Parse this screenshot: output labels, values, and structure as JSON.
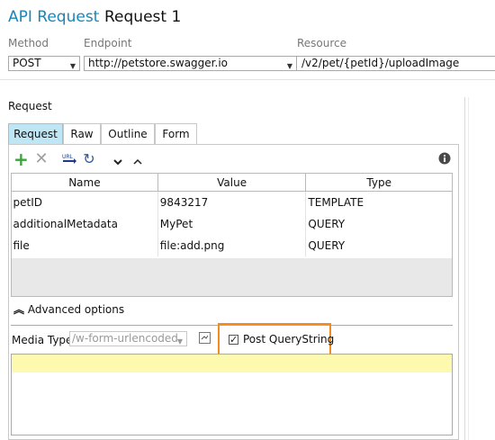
{
  "header": {
    "title_prefix": "API Request",
    "title": "Request 1"
  },
  "fields": {
    "method": {
      "label": "Method",
      "value": "POST"
    },
    "endpoint": {
      "label": "Endpoint",
      "value": "http://petstore.swagger.io"
    },
    "resource": {
      "label": "Resource",
      "value": "/v2/pet/{petId}/uploadImage"
    }
  },
  "request_section": {
    "label": "Request",
    "tabs": [
      {
        "label": "Request",
        "active": true
      },
      {
        "label": "Raw",
        "active": false
      },
      {
        "label": "Outline",
        "active": false
      },
      {
        "label": "Form",
        "active": false
      }
    ],
    "toolbar": {
      "icons": [
        "plus-icon",
        "delete-icon",
        "url-icon",
        "refresh-icon",
        "chevron-down-icon",
        "chevron-up-icon",
        "info-icon"
      ]
    },
    "params_table": {
      "columns": [
        "Name",
        "Value",
        "Type"
      ],
      "rows": [
        {
          "name": "petID",
          "value": "9843217",
          "type": "TEMPLATE"
        },
        {
          "name": "additionalMetadata",
          "value": "MyPet",
          "type": "QUERY"
        },
        {
          "name": "file",
          "value": "file:add.png",
          "type": "QUERY"
        }
      ]
    },
    "advanced_options": {
      "label": "Advanced options"
    },
    "media_type": {
      "label": "Media Type",
      "value": "/w-form-urlencoded"
    },
    "post_querystring": {
      "label": "Post QueryString",
      "checked": true
    }
  },
  "colors": {
    "accent": "#1a86b8",
    "active_tab": "#bfe6f5",
    "highlight": "#f28c1f",
    "editor_line": "#fdfab0",
    "add_icon": "#3aa23a"
  }
}
